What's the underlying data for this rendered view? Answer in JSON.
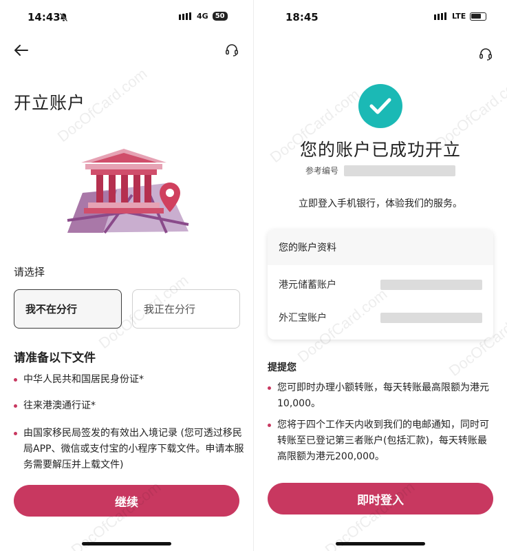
{
  "left": {
    "status": {
      "time": "14:43",
      "network": "4G",
      "battery": "50"
    },
    "title": "开立账户",
    "choose_label": "请选择",
    "options": [
      {
        "label": "我不在分行",
        "selected": true
      },
      {
        "label": "我正在分行",
        "selected": false
      }
    ],
    "documents_heading": "请准备以下文件",
    "documents": [
      "中华人民共和国居民身份证*",
      "往来港澳通行证*",
      "由国家移民局签发的有效出入境记录 (您可透过移民局APP、微信或支付宝的小程序下载文件。申请本服务需要解压并上载文件)"
    ],
    "continue_label": "继续"
  },
  "right": {
    "status": {
      "time": "18:45",
      "network": "LTE"
    },
    "success_title": "您的账户已成功开立",
    "reference_label": "参考编号",
    "login_hint": "立即登入手机银行，体验我们的服务。",
    "account_card": {
      "title": "您的账户资料",
      "rows": [
        {
          "label": "港元储蓄账户"
        },
        {
          "label": "外汇宝账户"
        }
      ]
    },
    "reminder_heading": "提提您",
    "reminders": [
      "您可即时办理小额转账，每天转账最高限额为港元10,000。",
      "您将于四个工作天内收到我们的电邮通知，同时可转账至已登记第三者账户(包括汇款)，每天转账最高限额为港元200,000。"
    ],
    "login_label": "即时登入"
  },
  "watermark": "DocOfCard.com",
  "colors": {
    "brand": "#c83860",
    "success": "#1bb9b5",
    "redaction": "#dcdcdc"
  },
  "icons": [
    "back-arrow-icon",
    "headset-icon",
    "bank-building-icon",
    "map-pin-icon",
    "checkmark-icon",
    "mute-bell-icon",
    "signal-icon",
    "battery-icon"
  ]
}
